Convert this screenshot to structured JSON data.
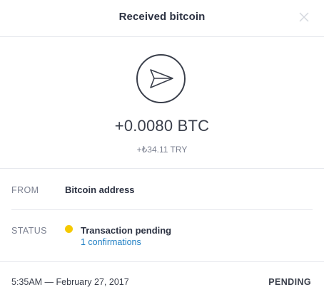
{
  "header": {
    "title": "Received bitcoin",
    "close_icon": "close-icon"
  },
  "hero": {
    "icon": "paper-plane-icon",
    "amount": "+0.0080 BTC",
    "fiat_amount": "+₺34.11 TRY"
  },
  "details": {
    "from_label": "FROM",
    "from_value": "Bitcoin address",
    "status_label": "STATUS",
    "status_value": "Transaction pending",
    "status_color": "#f5c900",
    "confirmations": "1 confirmations"
  },
  "footer": {
    "date": "5:35AM — February 27, 2017",
    "status": "PENDING"
  },
  "colors": {
    "link": "#1f7fc4",
    "text": "#3a3f4b",
    "muted": "#7b8090",
    "divider": "#e7e9ee"
  }
}
